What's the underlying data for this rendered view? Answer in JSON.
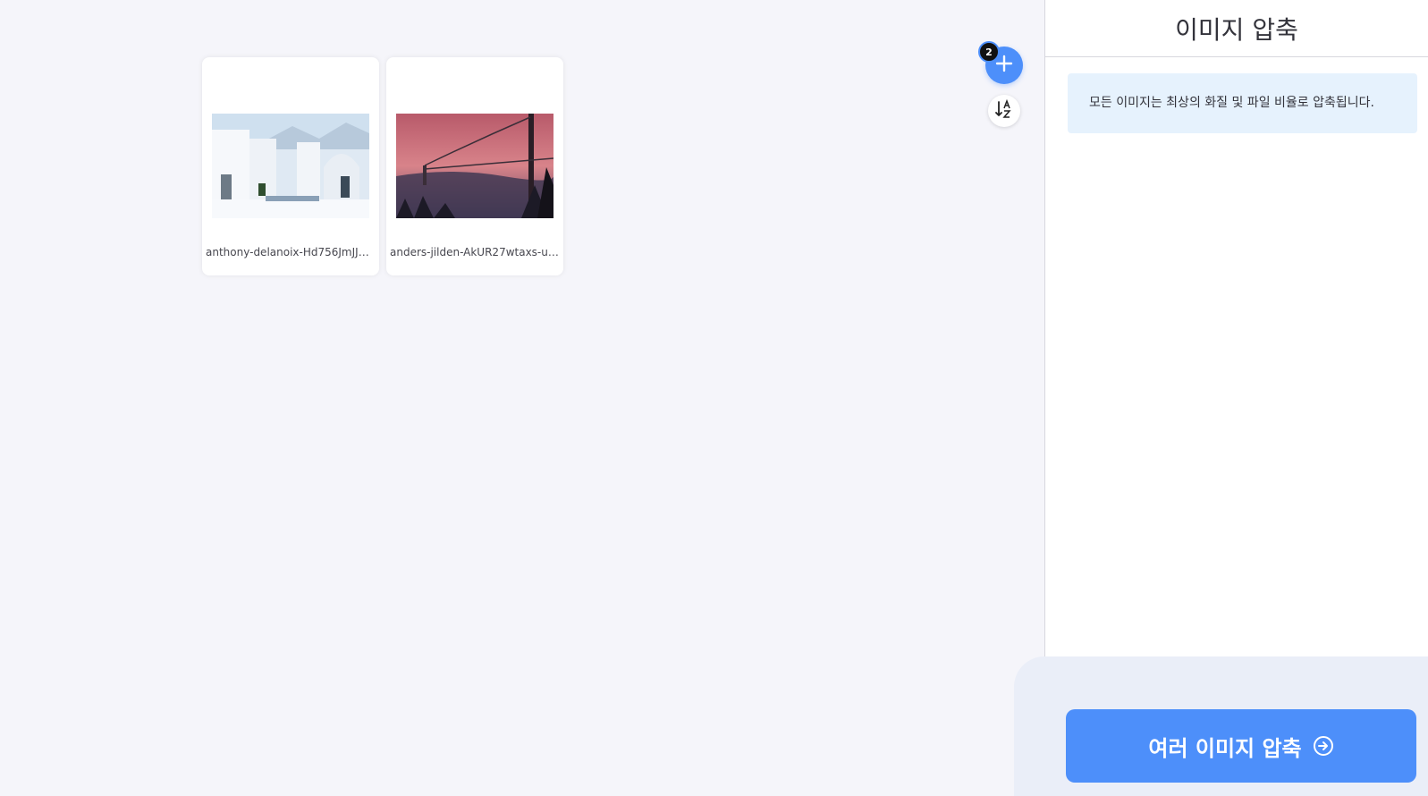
{
  "workspace": {
    "files": [
      {
        "name": "anthony-delanoix-Hd756JmJJE…",
        "thumb": "white-buildings-sea-photo"
      },
      {
        "name": "anders-jilden-AkUR27wtaxs-un…",
        "thumb": "bridge-sunset-fog-photo"
      }
    ],
    "file_count_badge": "2",
    "add_icon": "plus-icon",
    "sort_icon": "sort-az-icon"
  },
  "sidebar": {
    "title": "이미지 압축",
    "info_text": "모든 이미지는 최상의 화질 및 파일 비율로 압축됩니다.",
    "action_label": "여러 이미지 압축",
    "action_icon": "arrow-right-circle-icon"
  },
  "colors": {
    "accent": "#4d8ffa",
    "info_bg": "#e6f2fd",
    "workspace_bg": "#f5f5fa"
  }
}
